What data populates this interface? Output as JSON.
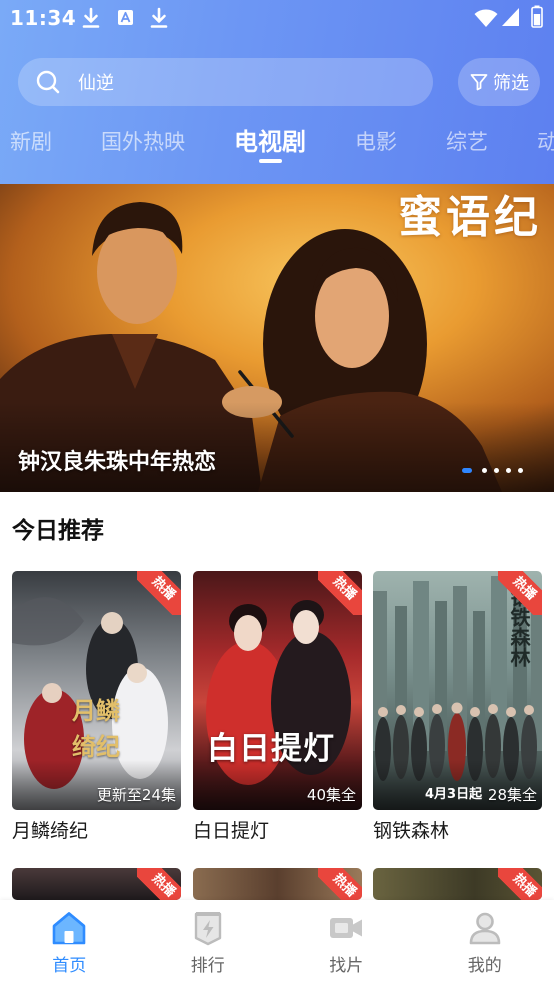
{
  "status_bar": {
    "time": "11:34",
    "left_icons": [
      "download-icon",
      "app-store-icon",
      "download-icon"
    ],
    "right_icons": [
      "wifi-icon",
      "signal-icon",
      "battery-icon"
    ]
  },
  "search": {
    "value": "仙逆",
    "icon": "search-icon"
  },
  "filter": {
    "label": "筛选",
    "icon": "filter-icon"
  },
  "tabs": [
    {
      "label": "新剧",
      "active": false
    },
    {
      "label": "国外热映",
      "active": false
    },
    {
      "label": "电视剧",
      "active": true
    },
    {
      "label": "电影",
      "active": false
    },
    {
      "label": "综艺",
      "active": false
    },
    {
      "label": "动",
      "active": false
    }
  ],
  "banner": {
    "caption": "钟汉良朱珠中年热恋",
    "poster_title": "蜜语纪",
    "slides": 5,
    "active_slide": 1
  },
  "section": {
    "title": "今日推荐"
  },
  "cards": [
    {
      "title": "月鳞绮纪",
      "badge": "热播",
      "episodes": "更新至24集",
      "poster_text": "月鳞绮纪"
    },
    {
      "title": "白日提灯",
      "badge": "热播",
      "episodes": "40集全",
      "poster_text": "白日提灯"
    },
    {
      "title": "钢铁森林",
      "badge": "热播",
      "episodes": "28集全",
      "poster_text": "钢铁森林",
      "poster_date": "4月3日起"
    }
  ],
  "cards_next_row": [
    {
      "badge": "热播"
    },
    {
      "badge": "热播"
    },
    {
      "badge": "热播"
    }
  ],
  "bottom_nav": [
    {
      "label": "首页",
      "icon": "home-icon",
      "active": true
    },
    {
      "label": "排行",
      "icon": "ranking-icon",
      "active": false
    },
    {
      "label": "找片",
      "icon": "video-camera-icon",
      "active": false
    },
    {
      "label": "我的",
      "icon": "user-icon",
      "active": false
    }
  ],
  "colors": {
    "header_start": "#7aaaf7",
    "header_end": "#5d80f0",
    "accent": "#2f8cff",
    "badge": "#e9463d",
    "tab_indicator": "#ffffff"
  }
}
